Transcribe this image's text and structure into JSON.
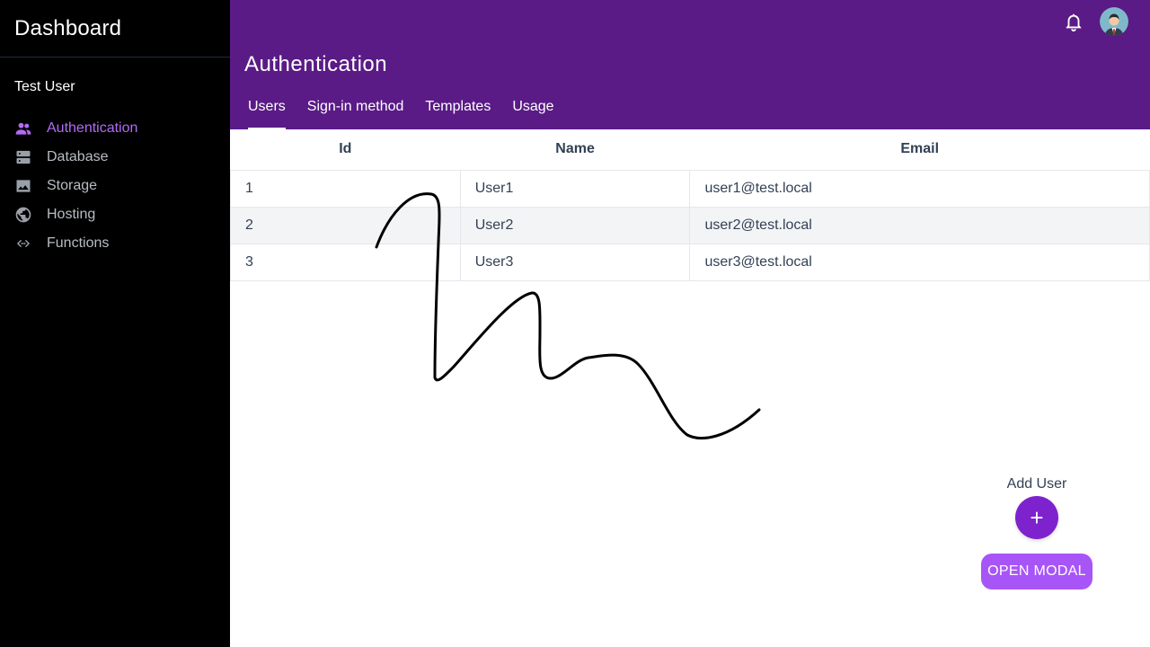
{
  "sidebar": {
    "brand": "Dashboard",
    "user_name": "Test User",
    "items": [
      {
        "label": "Authentication",
        "icon": "people-icon",
        "active": true
      },
      {
        "label": "Database",
        "icon": "database-icon",
        "active": false
      },
      {
        "label": "Storage",
        "icon": "image-icon",
        "active": false
      },
      {
        "label": "Hosting",
        "icon": "globe-icon",
        "active": false
      },
      {
        "label": "Functions",
        "icon": "code-icon",
        "active": false
      }
    ]
  },
  "header": {
    "title": "Authentication",
    "tabs": [
      {
        "label": "Users",
        "active": true
      },
      {
        "label": "Sign-in method",
        "active": false
      },
      {
        "label": "Templates",
        "active": false
      },
      {
        "label": "Usage",
        "active": false
      }
    ]
  },
  "table": {
    "columns": [
      "Id",
      "Name",
      "Email"
    ],
    "rows": [
      [
        "1",
        "User1",
        "user1@test.local"
      ],
      [
        "2",
        "User2",
        "user2@test.local"
      ],
      [
        "3",
        "User3",
        "user3@test.local"
      ]
    ]
  },
  "actions": {
    "add_user_label": "Add User",
    "add_button": "+",
    "open_modal_label": "OPEN MODAL"
  },
  "colors": {
    "sidebar_bg": "#000000",
    "header_bg": "#5a1b86",
    "accent": "#b26bf5",
    "fab": "#7e22ce",
    "modal_button": "#a855f7"
  }
}
